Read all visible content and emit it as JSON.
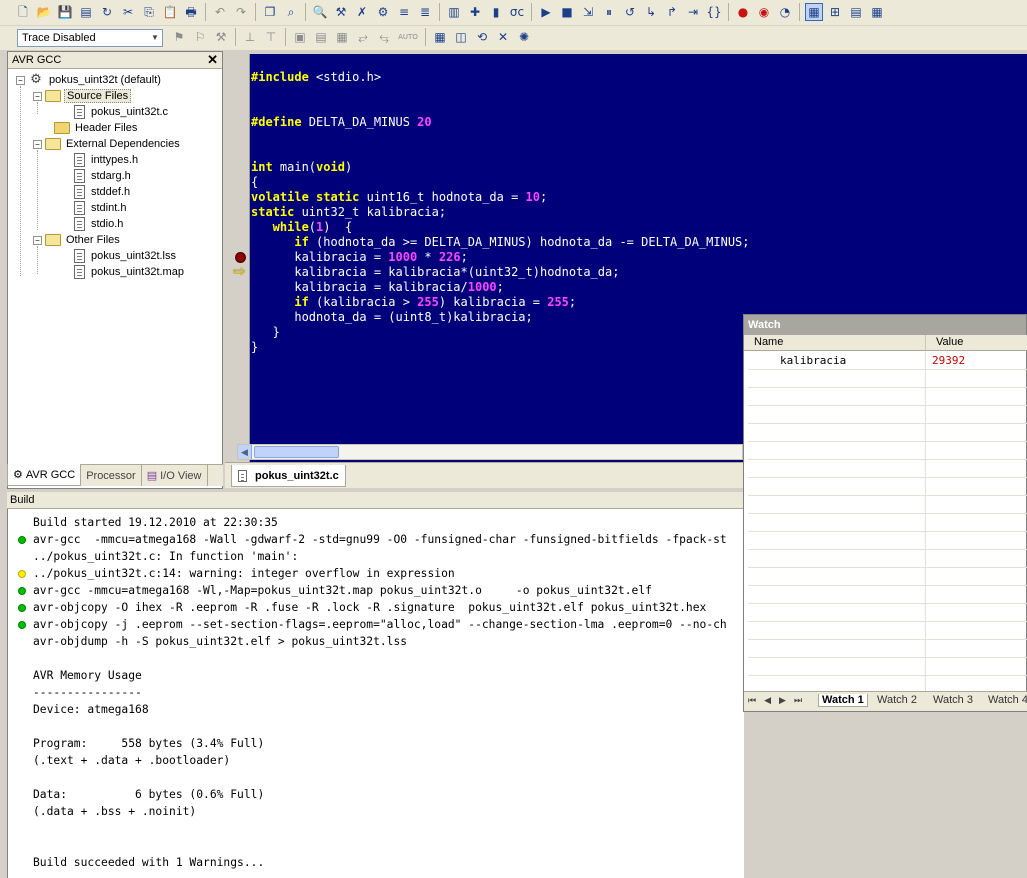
{
  "toolbar": {
    "row1_icons": [
      "new-file-icon",
      "open-icon",
      "save-icon",
      "save-all-icon",
      "reload-icon",
      "cut-icon",
      "copy-icon",
      "paste-icon",
      "print-icon",
      "undo-icon",
      "redo-icon",
      "windows-icon",
      "find-replace-icon",
      "binoculars-icon",
      "build-icon",
      "rebuild-icon",
      "clean-icon",
      "indent-icon",
      "outdent-icon",
      "connect-icon",
      "programmer-icon",
      "jtag-icon",
      "oc-icon",
      "run-icon",
      "stop-icon",
      "step-into-icon",
      "break-icon",
      "reset-icon",
      "step-over-icon",
      "step-out-icon",
      "run-to-cursor-icon",
      "auto-step-icon",
      "toggle-breakpoint-icon",
      "remove-breakpoints-icon",
      "quickwatch-icon",
      "disassembler-icon",
      "watch-icon",
      "memory-icon",
      "registers-icon"
    ],
    "row1_glyphs": [
      "🗋",
      "📂",
      "💾",
      "▤",
      "↻",
      "✂",
      "⎘",
      "📋",
      "🖶",
      "↶",
      "↷",
      "❐",
      "⌕",
      "🔍",
      "⚒",
      "✗",
      "⚙",
      "≡",
      "≣",
      "▥",
      "✚",
      "▮",
      "σc",
      "▶",
      "■",
      "⇲",
      "⏸",
      "↺",
      "↳",
      "↱",
      "⇥",
      "{}",
      "●",
      "◉",
      "◔",
      "▦",
      "⊞",
      "▤",
      "▦"
    ],
    "trace_combo": "Trace Disabled",
    "row2_glyphs": [
      "⚑",
      "⚐",
      "⚒",
      "⊥",
      "⊤",
      "▣",
      "▤",
      "▦",
      "⥂",
      "⥃",
      "AUTO",
      "▦",
      "◫",
      "⟲",
      "✕",
      "✺"
    ],
    "auto_label": "AUTO"
  },
  "left_panel": {
    "title": "AVR GCC",
    "close_glyph": "✕",
    "tree": {
      "project": "pokus_uint32t (default)",
      "source_files": "Source Files",
      "source_items": [
        "pokus_uint32t.c"
      ],
      "header_files": "Header Files",
      "external_deps": "External Dependencies",
      "external_items": [
        "inttypes.h",
        "stdarg.h",
        "stddef.h",
        "stdint.h",
        "stdio.h"
      ],
      "other_files": "Other Files",
      "other_items": [
        "pokus_uint32t.lss",
        "pokus_uint32t.map"
      ]
    },
    "tabs": [
      "AVR GCC",
      "Processor",
      "I/O View"
    ]
  },
  "editor": {
    "tab_label": "pokus_uint32t.c",
    "lines": {
      "l1_a": "#include",
      "l1_b": " <stdio.h>",
      "l2_a": "#define",
      "l2_b": " DELTA_DA_MINUS ",
      "l2_c": "20",
      "l3_a": "int",
      "l3_b": " main(",
      "l3_c": "void",
      "l3_d": ")",
      "l4": "{",
      "l5_a": "volatile static",
      "l5_b": " uint16_t hodnota_da = ",
      "l5_c": "10",
      "l5_d": ";",
      "l6_a": "static",
      "l6_b": " uint32_t kalibracia;",
      "l7_a": "   while",
      "l7_b": "(",
      "l7_c": "1",
      "l7_d": ")  {",
      "l8_a": "      if",
      "l8_b": " (hodnota_da >= DELTA_DA_MINUS) hodnota_da -= DELTA_DA_MINUS;",
      "l9_a": "      kalibracia = ",
      "l9_b": "1000",
      "l9_c": " * ",
      "l9_d": "226",
      "l9_e": ";",
      "l10": "      kalibracia = kalibracia*(uint32_t)hodnota_da;",
      "l11_a": "      kalibracia = kalibracia/",
      "l11_b": "1000",
      "l11_c": ";",
      "l12_a": "      if",
      "l12_b": " (kalibracia > ",
      "l12_c": "255",
      "l12_d": ") kalibracia = ",
      "l12_e": "255",
      "l12_f": ";",
      "l13": "      hodnota_da = (uint8_t)kalibracia;",
      "l14": "   }",
      "l15": "}"
    },
    "arrow_glyph": "⇨"
  },
  "build": {
    "title": "Build",
    "lines": [
      "Build started 19.12.2010 at 22:30:35",
      "avr-gcc  -mmcu=atmega168 -Wall -gdwarf-2 -std=gnu99 -O0 -funsigned-char -funsigned-bitfields -fpack-st",
      "../pokus_uint32t.c: In function 'main':",
      "../pokus_uint32t.c:14: warning: integer overflow in expression",
      "avr-gcc -mmcu=atmega168 -Wl,-Map=pokus_uint32t.map pokus_uint32t.o     -o pokus_uint32t.elf",
      "avr-objcopy -O ihex -R .eeprom -R .fuse -R .lock -R .signature  pokus_uint32t.elf pokus_uint32t.hex",
      "avr-objcopy -j .eeprom --set-section-flags=.eeprom=\"alloc,load\" --change-section-lma .eeprom=0 --no-ch",
      "avr-objdump -h -S pokus_uint32t.elf > pokus_uint32t.lss",
      "AVR Memory Usage",
      "----------------",
      "Device: atmega168",
      "Program:     558 bytes (3.4% Full)",
      "(.text + .data + .bootloader)",
      "Data:          6 bytes (0.6% Full)",
      "(.data + .bss + .noinit)",
      "Build succeeded with 1 Warnings..."
    ]
  },
  "watch": {
    "title": "Watch",
    "col_name": "Name",
    "col_value": "Value",
    "row_name": "kalibracia",
    "row_value": "29392",
    "nav_glyphs": [
      "⏮",
      "◀",
      "▶",
      "⏭"
    ],
    "tabs": [
      "Watch 1",
      "Watch 2",
      "Watch 3",
      "Watch 4"
    ]
  }
}
